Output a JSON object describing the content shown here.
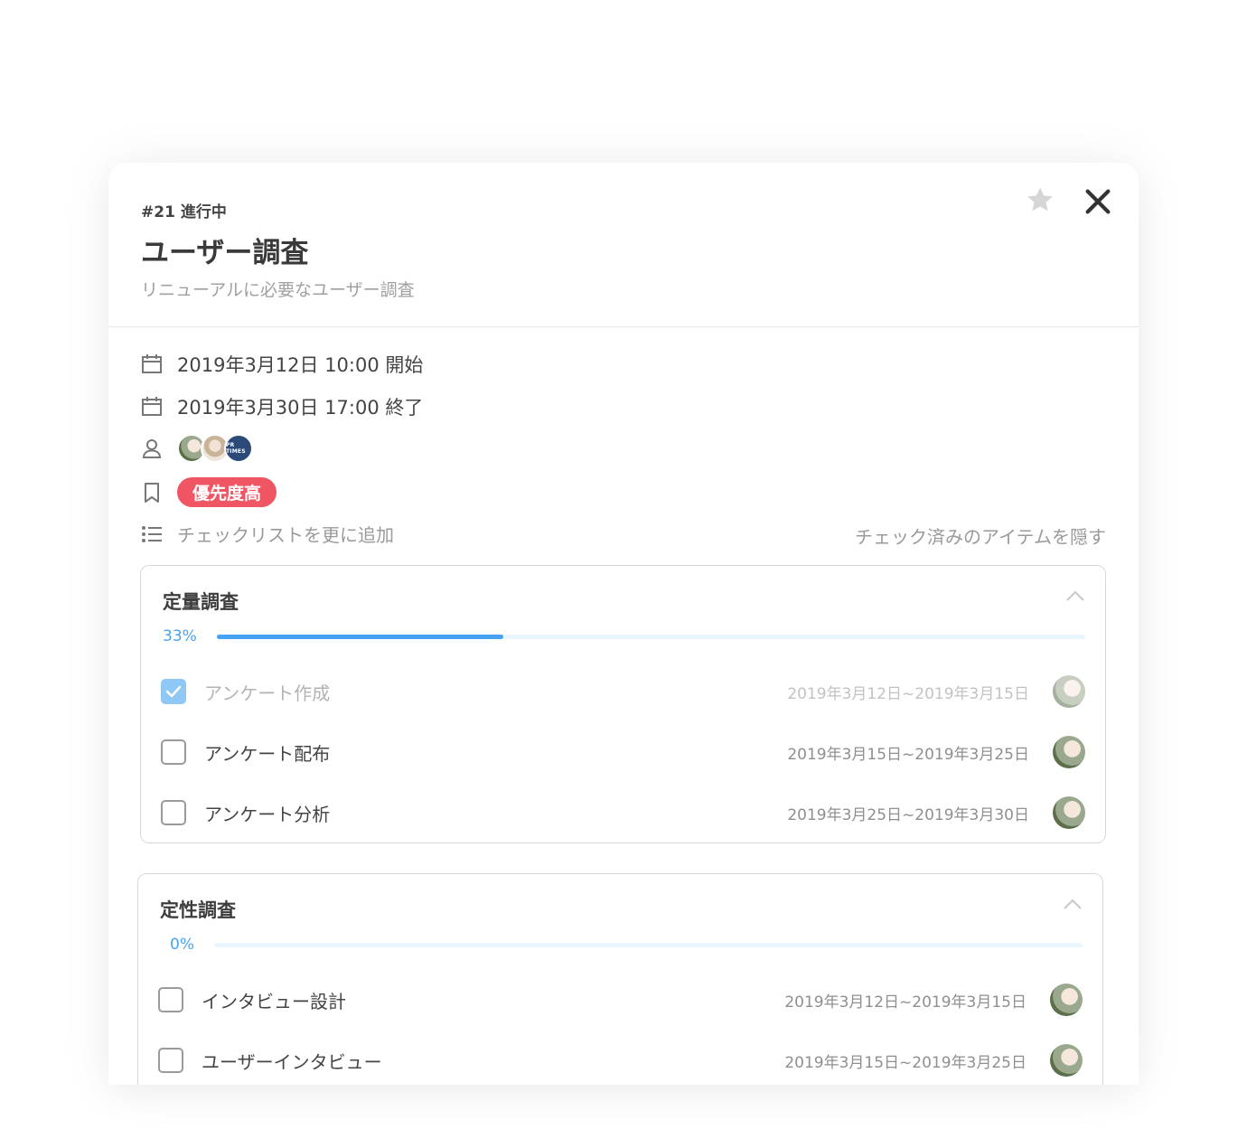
{
  "task": {
    "meta": "#21 進行中",
    "title": "ユーザー調査",
    "description": "リニューアルに必要なユーザー調査"
  },
  "details": {
    "start": "2019年3月12日 10:00 開始",
    "end": "2019年3月30日 17:00 終了",
    "assignee_badge_text": "PR TIMES",
    "tag": "優先度高"
  },
  "actions": {
    "add_checklist": "チェックリストを更に追加",
    "hide_checked": "チェック済みのアイテムを隠す"
  },
  "colors": {
    "accent": "#48a2f2",
    "tag": "#ef5563",
    "checked": "#8fc8f5"
  },
  "checklists": [
    {
      "title": "定量調査",
      "progress_label": "33%",
      "progress": 0.33,
      "items": [
        {
          "name": "アンケート作成",
          "dates": "2019年3月12日~2019年3月15日",
          "checked": true
        },
        {
          "name": "アンケート配布",
          "dates": "2019年3月15日~2019年3月25日",
          "checked": false
        },
        {
          "name": "アンケート分析",
          "dates": "2019年3月25日~2019年3月30日",
          "checked": false
        }
      ]
    },
    {
      "title": "定性調査",
      "progress_label": "0%",
      "progress": 0,
      "items": [
        {
          "name": "インタビュー設計",
          "dates": "2019年3月12日~2019年3月15日",
          "checked": false
        },
        {
          "name": "ユーザーインタビュー",
          "dates": "2019年3月15日~2019年3月25日",
          "checked": false
        }
      ]
    }
  ]
}
